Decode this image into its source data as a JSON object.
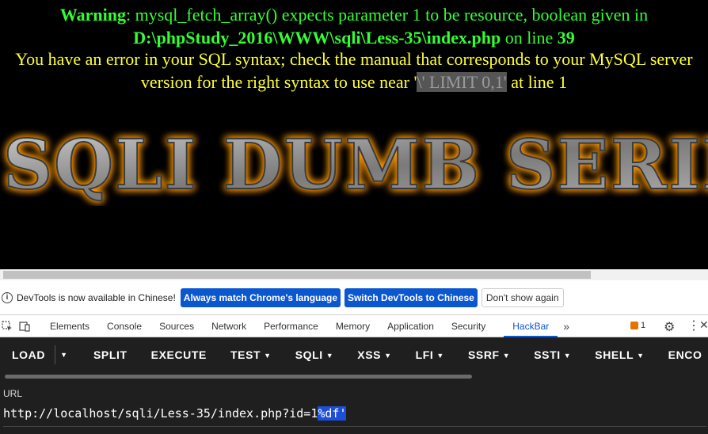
{
  "page": {
    "warning_label": "Warning",
    "warning_text": ": mysql_fetch_array() expects parameter 1 to be resource, boolean given in",
    "warning_path": "D:\\phpStudy_2016\\WWW\\sqli\\Less-35\\index.php",
    "warning_online": " on line ",
    "warning_line": "39",
    "sql_error_pre": "You have an error in your SQL syntax; check the manual that corresponds to your MySQL server version for the right syntax to use near '",
    "sql_error_highlight": "\\' LIMIT 0,1'",
    "sql_error_post": " at line 1",
    "banner_text": "SQLI DUMB SERIES",
    "colors": {
      "warning": "#33ff33",
      "sql_error": "#ffff33",
      "banner_glow": "#ff9900"
    }
  },
  "devtools": {
    "notice": {
      "message": "DevTools is now available in Chinese!",
      "btn_match": "Always match Chrome's language",
      "btn_switch": "Switch DevTools to Chinese",
      "btn_dismiss": "Don't show again"
    },
    "tabs": [
      "Elements",
      "Console",
      "Sources",
      "Network",
      "Performance",
      "Memory",
      "Application",
      "Security",
      "HackBar"
    ],
    "active_tab": "HackBar",
    "issues_count": "1"
  },
  "hackbar": {
    "menu": {
      "load": "LOAD",
      "split": "SPLIT",
      "execute": "EXECUTE",
      "test": "TEST",
      "sqli": "SQLI",
      "xss": "XSS",
      "lfi": "LFI",
      "ssrf": "SSRF",
      "ssti": "SSTI",
      "shell": "SHELL",
      "encoding": "ENCO"
    },
    "url_label": "URL",
    "url_value_prefix": "http://localhost/sqli/Less-35/index.php?id=1",
    "url_value_selected": "%df'"
  }
}
